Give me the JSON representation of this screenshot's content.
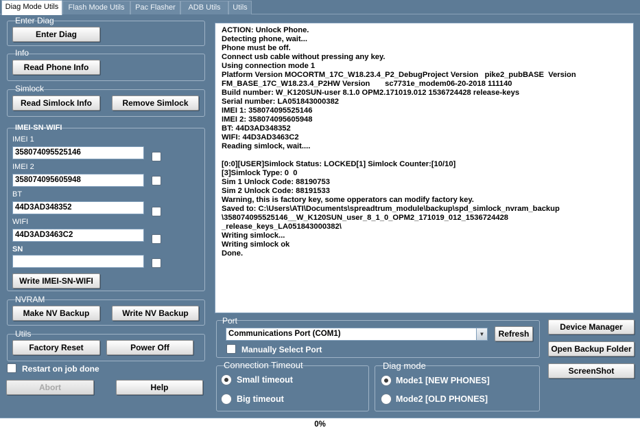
{
  "tabs": [
    "Diag Mode Utils",
    "Flash Mode Utils",
    "Pac Flasher",
    "ADB Utils",
    "Utils"
  ],
  "enter_diag": {
    "group": "Enter Diag",
    "button": "Enter Diag"
  },
  "info": {
    "group": "Info",
    "button": "Read Phone Info"
  },
  "simlock": {
    "group": "Simlock",
    "read_button": "Read Simlock Info",
    "remove_button": "Remove Simlock"
  },
  "imei_sn_wifi": {
    "group": "IMEI-SN-WIFI",
    "fields": [
      {
        "label": "IMEI 1",
        "value": "358074095525146"
      },
      {
        "label": "IMEI 2",
        "value": "358074095605948"
      },
      {
        "label": "BT",
        "value": "44D3AD348352"
      },
      {
        "label": "WIFI",
        "value": "44D3AD3463C2"
      },
      {
        "label": "SN",
        "value": ""
      }
    ],
    "write_button": "Write IMEI-SN-WIFI"
  },
  "nvram": {
    "group": "NVRAM",
    "make_button": "Make NV Backup",
    "write_button": "Write NV Backup"
  },
  "utils": {
    "group": "Utils",
    "factory_reset": "Factory Reset",
    "power_off": "Power Off"
  },
  "restart_label": "Restart on job done",
  "abort_button": "Abort",
  "help_button": "Help",
  "log_text": "ACTION: Unlock Phone.\nDetecting phone, wait...\nPhone must be off.\nConnect usb cable without pressing any key.\nUsing connection mode 1\nPlatform Version MOCORTM_17C_W18.23.4_P2_DebugProject Version   pike2_pubBASE  Version\nFM_BASE_17C_W18.23.4_P2HW Version       sc7731e_modem06-20-2018 111140\nBuild number: W_K120SUN-user 8.1.0 OPM2.171019.012 1536724428 release-keys\nSerial number: LA051843000382\nIMEI 1: 358074095525146\nIMEI 2: 358074095605948\nBT: 44D3AD348352\nWIFI: 44D3AD3463C2\nReading simlock, wait....\n\n[0:0][USER]Simlock Status: LOCKED[1] Simlock Counter:[10/10]\n[3]Simlock Type: 0  0\nSim 1 Unlock Code: 88190753\nSim 2 Unlock Code: 88191533\nWarning, this is factory key, some opperators can modify factory key.\nSaved to: C:\\Users\\ATI\\Documents\\spreadtrum_module\\backup\\spd_simlock_nvram_backup\n\\358074095525146__W_K120SUN_user_8_1_0_OPM2_171019_012_1536724428\n_release_keys_LA051843000382\\\nWriting simlock...\nWriting simlock ok\nDone.",
  "port": {
    "group": "Port",
    "selected": "Communications Port (COM1)",
    "refresh_button": "Refresh",
    "manual_label": "Manually Select Port"
  },
  "timeout": {
    "group": "Connection Timeout",
    "small": "Small timeout",
    "big": "Big timeout",
    "selected": "small"
  },
  "diag_mode": {
    "group": "Diag mode",
    "mode1": "Mode1  [NEW PHONES]",
    "mode2": "Mode2 [OLD PHONES]",
    "selected": "mode1"
  },
  "right_buttons": {
    "device_manager": "Device Manager",
    "open_backup": "Open Backup Folder",
    "screenshot": "ScreenShot"
  },
  "progress": {
    "text": "0%",
    "value": 0
  }
}
